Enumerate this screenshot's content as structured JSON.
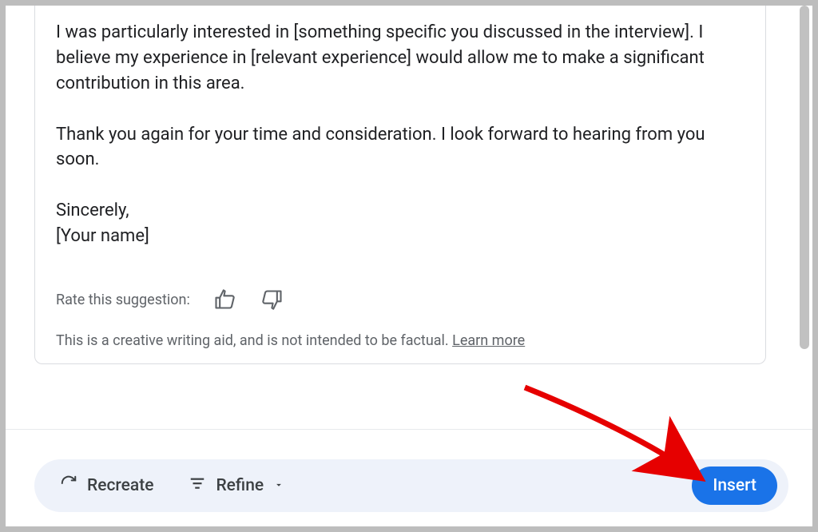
{
  "suggestion": {
    "paragraphs": [
      "I was particularly interested in [something specific you discussed in the interview]. I believe my experience in [relevant experience] would allow me to make a significant contribution in this area.",
      "Thank you again for your time and consideration. I look forward to hearing from you soon.",
      "Sincerely,\n[Your name]"
    ]
  },
  "rating": {
    "label": "Rate this suggestion:"
  },
  "disclaimer": {
    "text": "This is a creative writing aid, and is not intended to be factual. ",
    "link": "Learn more"
  },
  "actions": {
    "recreate": "Recreate",
    "refine": "Refine",
    "insert": "Insert"
  }
}
